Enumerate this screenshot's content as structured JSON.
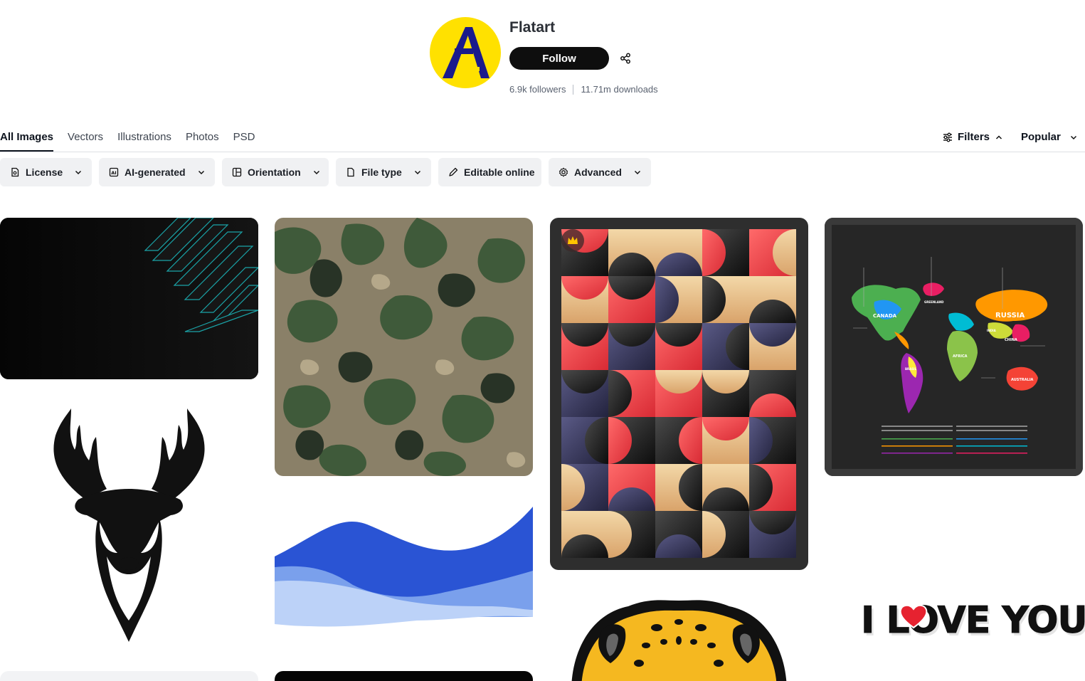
{
  "profile": {
    "name": "Flatart",
    "follow_label": "Follow",
    "followers": "6.9k followers",
    "downloads": "11.71m downloads",
    "avatar_color": "#ffe100",
    "logo_color": "#1a1a8c"
  },
  "tabs": [
    {
      "label": "All Images",
      "active": true
    },
    {
      "label": "Vectors",
      "active": false
    },
    {
      "label": "Illustrations",
      "active": false
    },
    {
      "label": "Photos",
      "active": false
    },
    {
      "label": "PSD",
      "active": false
    }
  ],
  "toolbar": {
    "filters_label": "Filters",
    "sort_label": "Popular"
  },
  "filter_chips": [
    {
      "label": "License",
      "icon": "license-icon",
      "has_dropdown": true
    },
    {
      "label": "AI-generated",
      "icon": "ai-icon",
      "has_dropdown": true
    },
    {
      "label": "Orientation",
      "icon": "orientation-icon",
      "has_dropdown": true
    },
    {
      "label": "File type",
      "icon": "file-icon",
      "has_dropdown": true
    },
    {
      "label": "Editable online",
      "icon": "pen-icon",
      "has_dropdown": false
    },
    {
      "label": "Advanced",
      "icon": "gear-icon",
      "has_dropdown": true
    }
  ],
  "gallery": {
    "items": [
      {
        "name": "dark-tech-stripes",
        "premium": false
      },
      {
        "name": "deer-head-line-art",
        "premium": false
      },
      {
        "name": "camouflage-pattern",
        "premium": false
      },
      {
        "name": "blue-waves",
        "premium": false
      },
      {
        "name": "geometric-bauhaus-pattern",
        "premium": true
      },
      {
        "name": "leopard-face",
        "premium": false
      },
      {
        "name": "world-map-infographic",
        "premium": false
      },
      {
        "name": "i-love-you-sticker",
        "premium": false
      }
    ],
    "map_labels": [
      "CANADA",
      "GREENLAND",
      "RUSSIA",
      "CHINA",
      "BRASIL",
      "AFRICA",
      "INDIA",
      "AUSTRALIA"
    ],
    "sticker_text": "I LOVE YOU"
  }
}
